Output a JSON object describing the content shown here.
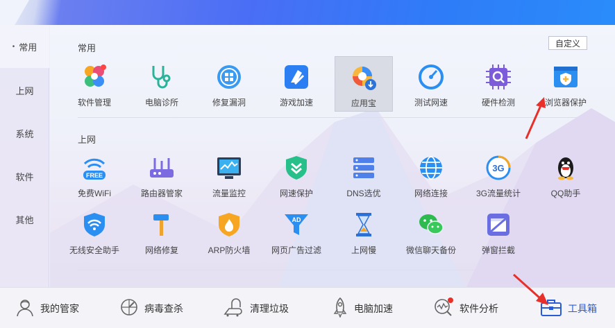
{
  "sidebar": {
    "items": [
      {
        "label": "常用",
        "active": true
      },
      {
        "label": "上网"
      },
      {
        "label": "系统"
      },
      {
        "label": "软件"
      },
      {
        "label": "其他"
      }
    ]
  },
  "main": {
    "custom_button": "自定义",
    "sections": [
      {
        "title": "常用",
        "tools": [
          {
            "label": "软件管理",
            "icon": "software-manager-icon"
          },
          {
            "label": "电脑诊所",
            "icon": "stethoscope-icon"
          },
          {
            "label": "修复漏洞",
            "icon": "windows-repair-icon"
          },
          {
            "label": "游戏加速",
            "icon": "game-boost-icon"
          },
          {
            "label": "应用宝",
            "icon": "app-store-icon",
            "highlighted": true
          },
          {
            "label": "测试网速",
            "icon": "speedometer-icon"
          },
          {
            "label": "硬件检测",
            "icon": "chip-search-icon"
          },
          {
            "label": "浏览器保护",
            "icon": "browser-shield-icon"
          }
        ]
      },
      {
        "title": "上网",
        "tools": [
          {
            "label": "免费WiFi",
            "icon": "free-wifi-icon",
            "badge": "FREE"
          },
          {
            "label": "路由器管家",
            "icon": "router-icon"
          },
          {
            "label": "流量监控",
            "icon": "traffic-monitor-icon"
          },
          {
            "label": "网速保护",
            "icon": "speed-shield-icon"
          },
          {
            "label": "DNS选优",
            "icon": "dns-server-icon"
          },
          {
            "label": "网络连接",
            "icon": "globe-icon"
          },
          {
            "label": "3G流量统计",
            "icon": "3g-icon",
            "badge": "3G"
          },
          {
            "label": "QQ助手",
            "icon": "qq-penguin-icon"
          },
          {
            "label": "无线安全助手",
            "icon": "wifi-shield-icon"
          },
          {
            "label": "网络修复",
            "icon": "hammer-icon"
          },
          {
            "label": "ARP防火墙",
            "icon": "firewall-icon"
          },
          {
            "label": "网页广告过滤",
            "icon": "ad-filter-icon",
            "badge": "AD"
          },
          {
            "label": "上网慢",
            "icon": "hourglass-icon"
          },
          {
            "label": "微信聊天备份",
            "icon": "wechat-icon"
          },
          {
            "label": "弹窗拦截",
            "icon": "popup-block-icon"
          }
        ]
      }
    ]
  },
  "bottom_nav": [
    {
      "label": "我的管家",
      "icon": "butler-icon"
    },
    {
      "label": "病毒查杀",
      "icon": "virus-scan-icon"
    },
    {
      "label": "清理垃圾",
      "icon": "vacuum-icon"
    },
    {
      "label": "电脑加速",
      "icon": "rocket-icon"
    },
    {
      "label": "软件分析",
      "icon": "analysis-icon"
    },
    {
      "label": "工具箱",
      "icon": "toolbox-icon",
      "active": true
    }
  ],
  "colors": {
    "accent": "#2a5bd7",
    "annotation": "#e8302a",
    "brand_blue": "#3a7bf6"
  }
}
